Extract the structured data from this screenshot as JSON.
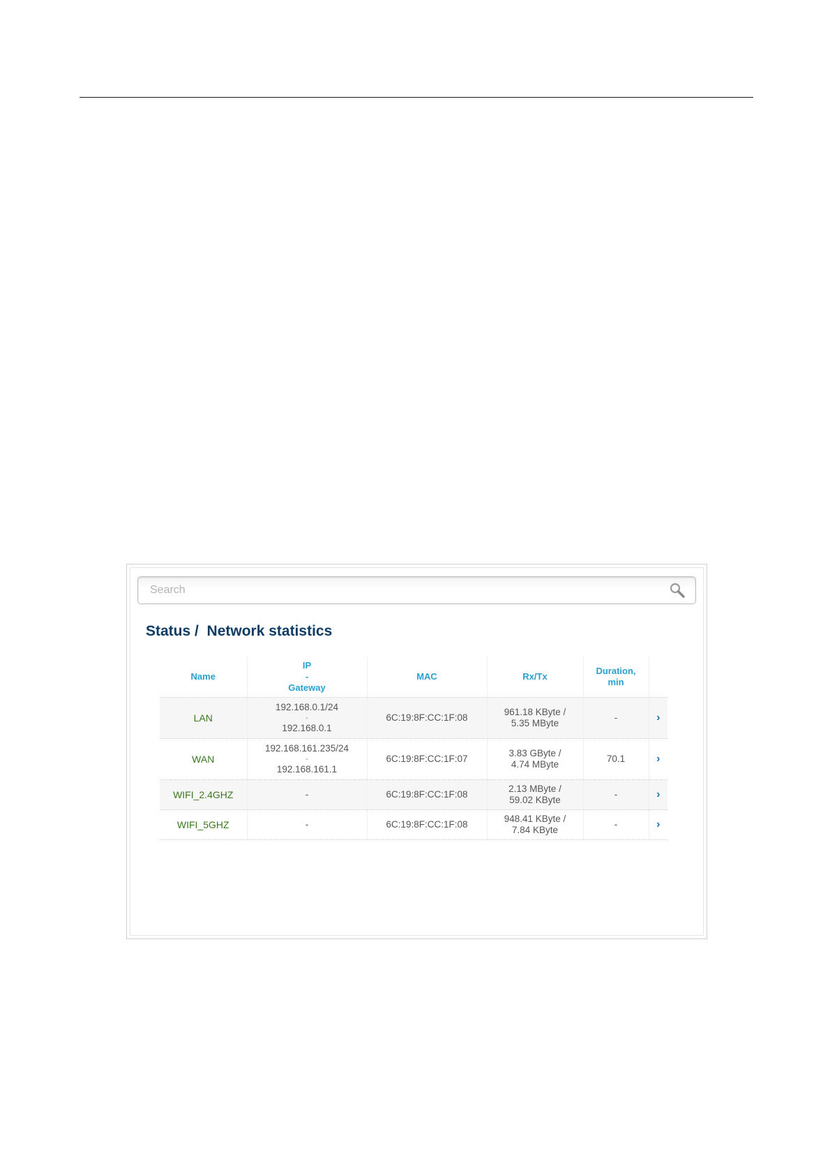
{
  "search": {
    "placeholder": "Search"
  },
  "page": {
    "title_section": "Status /",
    "title_page": "Network statistics"
  },
  "table": {
    "headers": {
      "name": "Name",
      "ip": "IP",
      "ip_sep": "-",
      "gateway": "Gateway",
      "mac": "MAC",
      "rxtx": "Rx/Tx",
      "duration_1": "Duration,",
      "duration_2": "min"
    },
    "rows": [
      {
        "name": "LAN",
        "ip": "192.168.0.1/24",
        "ip_sep": "-",
        "gateway": "192.168.0.1",
        "mac": "6C:19:8F:CC:1F:08",
        "rx": "961.18 KByte /",
        "tx": "5.35 MByte",
        "duration": "-"
      },
      {
        "name": "WAN",
        "ip": "192.168.161.235/24",
        "ip_sep": "-",
        "gateway": "192.168.161.1",
        "mac": "6C:19:8F:CC:1F:07",
        "rx": "3.83 GByte /",
        "tx": "4.74 MByte",
        "duration": "70.1"
      },
      {
        "name": "WIFI_2.4GHZ",
        "ip": "-",
        "mac": "6C:19:8F:CC:1F:08",
        "rx": "2.13 MByte /",
        "tx": "59.02 KByte",
        "duration": "-"
      },
      {
        "name": "WIFI_5GHZ",
        "ip": "-",
        "mac": "6C:19:8F:CC:1F:08",
        "rx": "948.41 KByte /",
        "tx": "7.84 KByte",
        "duration": "-"
      }
    ],
    "row_action_icon": "chevron-right-icon"
  },
  "colors": {
    "title": "#0f3c64",
    "header": "#2aa0cf",
    "name": "#3a7a1f",
    "chevron": "#1676b6"
  }
}
